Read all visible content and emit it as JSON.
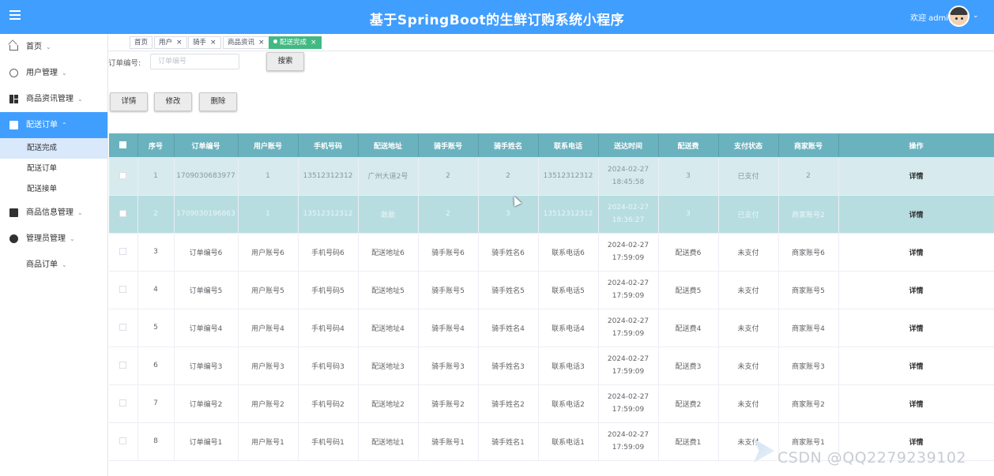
{
  "header": {
    "title": "基于SpringBoot的生鲜订购系统小程序",
    "welcome": "欢迎 admin",
    "caret": "⌄"
  },
  "sidebar": {
    "items": [
      {
        "label": "首页"
      },
      {
        "label": "用户管理"
      },
      {
        "label": "商品资讯管理"
      },
      {
        "label": "配送订单",
        "expanded": true,
        "children": [
          {
            "label": "配送完成"
          },
          {
            "label": "配送订单"
          },
          {
            "label": "配送接单"
          }
        ]
      },
      {
        "label": "商品信息管理"
      },
      {
        "label": "管理员管理"
      },
      {
        "label": "商品订单"
      }
    ],
    "chevron_down": "⌄",
    "chevron_up": "⌃"
  },
  "tabs": [
    {
      "label": "首页"
    },
    {
      "label": "用户",
      "close": "×"
    },
    {
      "label": "骑手",
      "close": "×"
    },
    {
      "label": "商品资讯",
      "close": "×"
    },
    {
      "label": "配送完成",
      "close": "×",
      "active": true
    }
  ],
  "search": {
    "label": "订单编号:",
    "placeholder": "订单编号",
    "button": "搜索"
  },
  "actions": {
    "detail": "详情",
    "edit": "修改",
    "delete": "删除"
  },
  "table": {
    "columns": [
      "序号",
      "订单编号",
      "用户账号",
      "手机号码",
      "配送地址",
      "骑手账号",
      "骑手姓名",
      "联系电话",
      "送达时间",
      "配送费",
      "支付状态",
      "商家账号",
      "操作"
    ],
    "rows": [
      [
        "1",
        "1709030683977",
        "1",
        "13512312312",
        "广州大道2号",
        "2",
        "2",
        "13512312312",
        "2024-02-27 18:45:58",
        "3",
        "已支付",
        "2",
        "详情"
      ],
      [
        "2",
        "1709030196863",
        "1",
        "13512312312",
        "敢敢",
        "2",
        "3",
        "13512312312",
        "2024-02-27 18:36:27",
        "3",
        "已支付",
        "商家账号2",
        "详情"
      ],
      [
        "3",
        "订单编号6",
        "用户账号6",
        "手机号码6",
        "配送地址6",
        "骑手账号6",
        "骑手姓名6",
        "联系电话6",
        "2024-02-27 17:59:09",
        "配送费6",
        "未支付",
        "商家账号6",
        "详情"
      ],
      [
        "4",
        "订单编号5",
        "用户账号5",
        "手机号码5",
        "配送地址5",
        "骑手账号5",
        "骑手姓名5",
        "联系电话5",
        "2024-02-27 17:59:09",
        "配送费5",
        "未支付",
        "商家账号5",
        "详情"
      ],
      [
        "5",
        "订单编号4",
        "用户账号4",
        "手机号码4",
        "配送地址4",
        "骑手账号4",
        "骑手姓名4",
        "联系电话4",
        "2024-02-27 17:59:09",
        "配送费4",
        "未支付",
        "商家账号4",
        "详情"
      ],
      [
        "6",
        "订单编号3",
        "用户账号3",
        "手机号码3",
        "配送地址3",
        "骑手账号3",
        "骑手姓名3",
        "联系电话3",
        "2024-02-27 17:59:09",
        "配送费3",
        "未支付",
        "商家账号3",
        "详情"
      ],
      [
        "7",
        "订单编号2",
        "用户账号2",
        "手机号码2",
        "配送地址2",
        "骑手账号2",
        "骑手姓名2",
        "联系电话2",
        "2024-02-27 17:59:09",
        "配送费2",
        "未支付",
        "商家账号2",
        "详情"
      ],
      [
        "8",
        "订单编号1",
        "用户账号1",
        "手机号码1",
        "配送地址1",
        "骑手账号1",
        "骑手姓名1",
        "联系电话1",
        "2024-02-27 17:59:09",
        "配送费1",
        "未支付",
        "商家账号1",
        "详情"
      ]
    ]
  },
  "watermark": "CSDN @QQ2279239102",
  "colors": {
    "header": "#409eff",
    "table_header": "#6bb2bf",
    "active_tab": "#42b983",
    "active_menu": "#409eff"
  }
}
